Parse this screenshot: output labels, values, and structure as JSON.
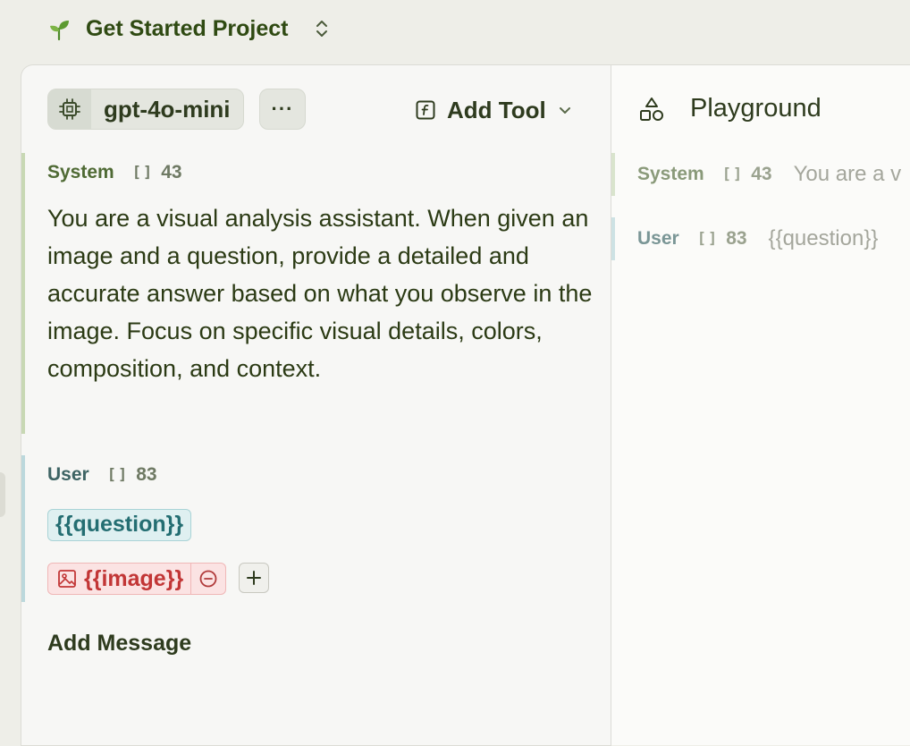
{
  "project": {
    "name": "Get Started Project",
    "icon": "sprout-icon",
    "switcher_icon": "chevron-up-down-icon"
  },
  "model": {
    "name": "gpt-4o-mini",
    "icon": "chip-icon"
  },
  "more_button": {
    "label": "···"
  },
  "add_tool": {
    "label": "Add Tool",
    "icon": "function-icon",
    "dropdown_icon": "chevron-down-icon"
  },
  "messages": [
    {
      "role": "System",
      "token_count": "43",
      "token_icon": "brackets-icon",
      "text": "You are a visual analysis assistant. When given an image and a question, provide a detailed and accurate answer based on what you observe in the image. Focus on specific visual details, colors, composition, and context."
    },
    {
      "role": "User",
      "token_count": "83",
      "token_icon": "brackets-icon",
      "variable": "{{question}}",
      "image_variable": "{{image}}",
      "image_icon": "image-icon",
      "remove_icon": "minus-circle-icon",
      "add_icon": "plus-icon"
    }
  ],
  "add_message": {
    "label": "Add Message"
  },
  "playground": {
    "title": "Playground",
    "icon": "shapes-icon",
    "rows": [
      {
        "role": "System",
        "token_count": "43",
        "preview": "You are a v"
      },
      {
        "role": "User",
        "token_count": "83",
        "preview": "{{question}}"
      }
    ]
  },
  "colors": {
    "accent_green": "#2f4a12",
    "system_border": "#c8d8b4",
    "user_border": "#bcd8dc",
    "variable_teal": "#246e72",
    "image_red": "#c23636"
  }
}
